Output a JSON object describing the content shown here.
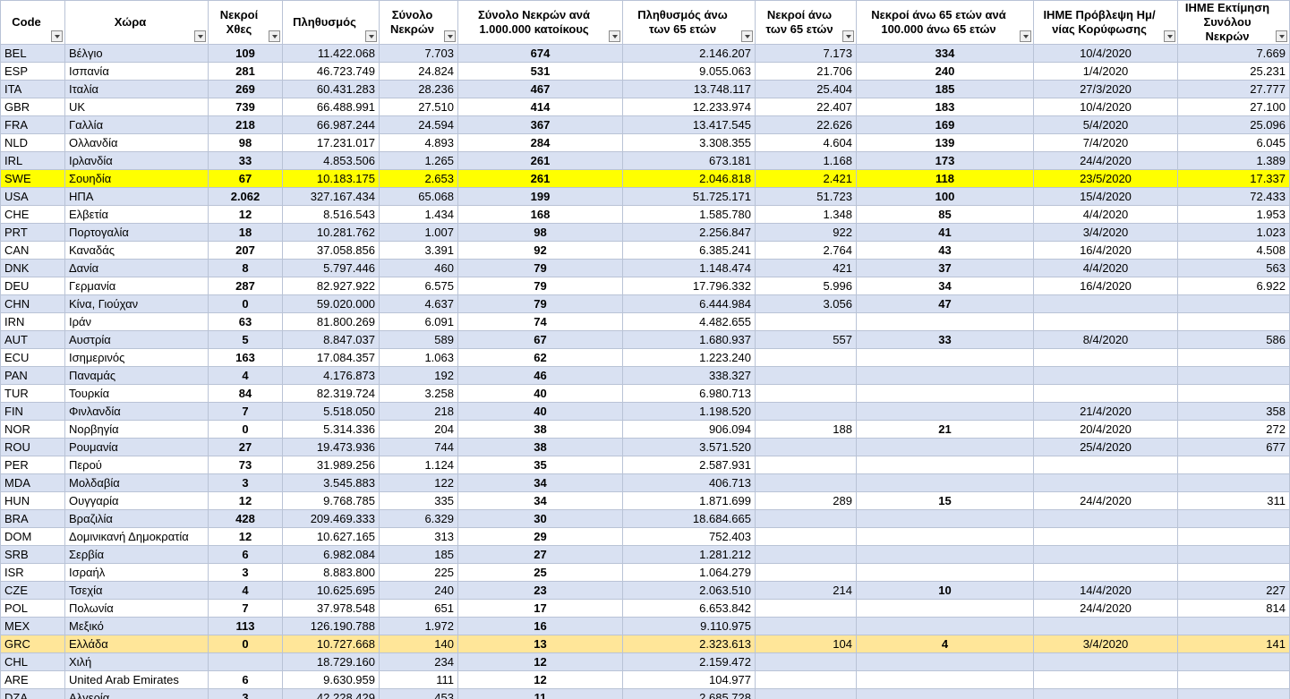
{
  "headers": [
    "Code",
    "Χώρα",
    "Νεκροί Χθες",
    "Πληθυσμός",
    "Σύνολο Νεκρών",
    "Σύνολο Νεκρών ανά 1.000.000 κατοίκους",
    "Πληθυσμός άνω των 65 ετών",
    "Νεκροί άνω των 65 ετών",
    "Νεκροί άνω 65 ετών ανά 100.000 άνω 65 ετών",
    "IHME Πρόβλεψη Ημ/νίας Κορύφωσης",
    "IHME Εκτίμηση Συνόλου Νεκρών"
  ],
  "rows": [
    [
      "BEL",
      "Βέλγιο",
      "109",
      "11.422.068",
      "7.703",
      "674",
      "2.146.207",
      "7.173",
      "334",
      "10/4/2020",
      "7.669"
    ],
    [
      "ESP",
      "Ισπανία",
      "281",
      "46.723.749",
      "24.824",
      "531",
      "9.055.063",
      "21.706",
      "240",
      "1/4/2020",
      "25.231"
    ],
    [
      "ITA",
      "Ιταλία",
      "269",
      "60.431.283",
      "28.236",
      "467",
      "13.748.117",
      "25.404",
      "185",
      "27/3/2020",
      "27.777"
    ],
    [
      "GBR",
      "UK",
      "739",
      "66.488.991",
      "27.510",
      "414",
      "12.233.974",
      "22.407",
      "183",
      "10/4/2020",
      "27.100"
    ],
    [
      "FRA",
      "Γαλλία",
      "218",
      "66.987.244",
      "24.594",
      "367",
      "13.417.545",
      "22.626",
      "169",
      "5/4/2020",
      "25.096"
    ],
    [
      "NLD",
      "Ολλανδία",
      "98",
      "17.231.017",
      "4.893",
      "284",
      "3.308.355",
      "4.604",
      "139",
      "7/4/2020",
      "6.045"
    ],
    [
      "IRL",
      "Ιρλανδία",
      "33",
      "4.853.506",
      "1.265",
      "261",
      "673.181",
      "1.168",
      "173",
      "24/4/2020",
      "1.389"
    ],
    [
      "SWE",
      "Σουηδία",
      "67",
      "10.183.175",
      "2.653",
      "261",
      "2.046.818",
      "2.421",
      "118",
      "23/5/2020",
      "17.337"
    ],
    [
      "USA",
      "ΗΠΑ",
      "2.062",
      "327.167.434",
      "65.068",
      "199",
      "51.725.171",
      "51.723",
      "100",
      "15/4/2020",
      "72.433"
    ],
    [
      "CHE",
      "Ελβετία",
      "12",
      "8.516.543",
      "1.434",
      "168",
      "1.585.780",
      "1.348",
      "85",
      "4/4/2020",
      "1.953"
    ],
    [
      "PRT",
      "Πορτογαλία",
      "18",
      "10.281.762",
      "1.007",
      "98",
      "2.256.847",
      "922",
      "41",
      "3/4/2020",
      "1.023"
    ],
    [
      "CAN",
      "Καναδάς",
      "207",
      "37.058.856",
      "3.391",
      "92",
      "6.385.241",
      "2.764",
      "43",
      "16/4/2020",
      "4.508"
    ],
    [
      "DNK",
      "Δανία",
      "8",
      "5.797.446",
      "460",
      "79",
      "1.148.474",
      "421",
      "37",
      "4/4/2020",
      "563"
    ],
    [
      "DEU",
      "Γερμανία",
      "287",
      "82.927.922",
      "6.575",
      "79",
      "17.796.332",
      "5.996",
      "34",
      "16/4/2020",
      "6.922"
    ],
    [
      "CHN",
      "Κίνα, Γιούχαν",
      "0",
      "59.020.000",
      "4.637",
      "79",
      "6.444.984",
      "3.056",
      "47",
      "",
      ""
    ],
    [
      "IRN",
      "Ιράν",
      "63",
      "81.800.269",
      "6.091",
      "74",
      "4.482.655",
      "",
      "",
      "",
      ""
    ],
    [
      "AUT",
      "Αυστρία",
      "5",
      "8.847.037",
      "589",
      "67",
      "1.680.937",
      "557",
      "33",
      "8/4/2020",
      "586"
    ],
    [
      "ECU",
      "Ισημερινός",
      "163",
      "17.084.357",
      "1.063",
      "62",
      "1.223.240",
      "",
      "",
      "",
      ""
    ],
    [
      "PAN",
      "Παναμάς",
      "4",
      "4.176.873",
      "192",
      "46",
      "338.327",
      "",
      "",
      "",
      ""
    ],
    [
      "TUR",
      "Τουρκία",
      "84",
      "82.319.724",
      "3.258",
      "40",
      "6.980.713",
      "",
      "",
      "",
      ""
    ],
    [
      "FIN",
      "Φινλανδία",
      "7",
      "5.518.050",
      "218",
      "40",
      "1.198.520",
      "",
      "",
      "21/4/2020",
      "358"
    ],
    [
      "NOR",
      "Νορβηγία",
      "0",
      "5.314.336",
      "204",
      "38",
      "906.094",
      "188",
      "21",
      "20/4/2020",
      "272"
    ],
    [
      "ROU",
      "Ρουμανία",
      "27",
      "19.473.936",
      "744",
      "38",
      "3.571.520",
      "",
      "",
      "25/4/2020",
      "677"
    ],
    [
      "PER",
      "Περού",
      "73",
      "31.989.256",
      "1.124",
      "35",
      "2.587.931",
      "",
      "",
      "",
      ""
    ],
    [
      "MDA",
      "Μολδαβία",
      "3",
      "3.545.883",
      "122",
      "34",
      "406.713",
      "",
      "",
      "",
      ""
    ],
    [
      "HUN",
      "Ουγγαρία",
      "12",
      "9.768.785",
      "335",
      "34",
      "1.871.699",
      "289",
      "15",
      "24/4/2020",
      "311"
    ],
    [
      "BRA",
      "Βραζιλία",
      "428",
      "209.469.333",
      "6.329",
      "30",
      "18.684.665",
      "",
      "",
      "",
      ""
    ],
    [
      "DOM",
      "Δομινικανή Δημοκρατία",
      "12",
      "10.627.165",
      "313",
      "29",
      "752.403",
      "",
      "",
      "",
      ""
    ],
    [
      "SRB",
      "Σερβία",
      "6",
      "6.982.084",
      "185",
      "27",
      "1.281.212",
      "",
      "",
      "",
      ""
    ],
    [
      "ISR",
      "Ισραήλ",
      "3",
      "8.883.800",
      "225",
      "25",
      "1.064.279",
      "",
      "",
      "",
      ""
    ],
    [
      "CZE",
      "Τσεχία",
      "4",
      "10.625.695",
      "240",
      "23",
      "2.063.510",
      "214",
      "10",
      "14/4/2020",
      "227"
    ],
    [
      "POL",
      "Πολωνία",
      "7",
      "37.978.548",
      "651",
      "17",
      "6.653.842",
      "",
      "",
      "24/4/2020",
      "814"
    ],
    [
      "MEX",
      "Μεξικό",
      "113",
      "126.190.788",
      "1.972",
      "16",
      "9.110.975",
      "",
      "",
      "",
      ""
    ],
    [
      "GRC",
      "Ελλάδα",
      "0",
      "10.727.668",
      "140",
      "13",
      "2.323.613",
      "104",
      "4",
      "3/4/2020",
      "141"
    ],
    [
      "CHL",
      "Χιλή",
      "",
      "18.729.160",
      "234",
      "12",
      "2.159.472",
      "",
      "",
      "",
      ""
    ],
    [
      "ARE",
      "United Arab Emirates",
      "6",
      "9.630.959",
      "111",
      "12",
      "104.977",
      "",
      "",
      "",
      ""
    ],
    [
      "DZA",
      "Αλγερία",
      "3",
      "42.228.429",
      "453",
      "11",
      "2.685.728",
      "",
      "",
      "",
      ""
    ]
  ],
  "row_highlights": {
    "7": "yellow",
    "33": "peach"
  },
  "colors": {
    "band": "#d9e1f2",
    "highlight_yellow": "#ffff00",
    "highlight_peach": "#ffe699",
    "grid": "#b9c3d6"
  }
}
